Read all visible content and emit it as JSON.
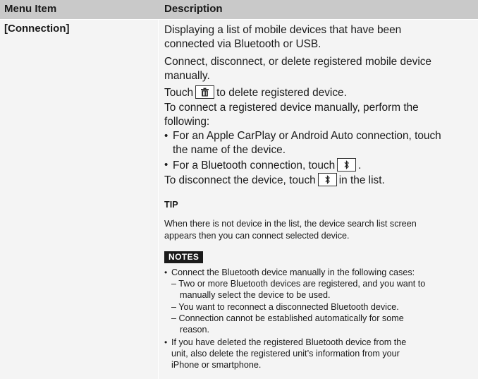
{
  "header": {
    "col1": "Menu Item",
    "col2": "Description"
  },
  "row": {
    "menu_item": "[Connection]",
    "lines": {
      "l1": "Displaying a list of mobile devices that have been",
      "l2": "connected via Bluetooth or USB.",
      "l3": "Connect, disconnect, or delete registered mobile device",
      "l4": "manually.",
      "l5a": "Touch",
      "l5b": "to delete registered device.",
      "l6": "To connect a registered device manually, perform the",
      "l7": "following:",
      "b1a": "For an Apple CarPlay or Android Auto connection, touch",
      "b1b": "the name of the device.",
      "b2a": "For a Bluetooth connection, touch",
      "b2b": ".",
      "l8a": "To disconnect the device, touch",
      "l8b": "in the list."
    },
    "tip": {
      "title": "TIP",
      "l1": "When there is not device in the list, the device search list screen",
      "l2": "appears then you can connect selected device."
    },
    "notes": {
      "title": "NOTES",
      "n1": "Connect the Bluetooth device manually in the following cases:",
      "n1a1": "– Two or more Bluetooth devices are registered, and you want to",
      "n1a2": "manually select the device to be used.",
      "n1b": "– You want to reconnect a disconnected Bluetooth device.",
      "n1c1": "– Connection cannot be established automatically for some",
      "n1c2": "reason.",
      "n2a": "If you have deleted the registered Bluetooth device from the",
      "n2b": "unit, also delete the registered unit’s information from your",
      "n2c": "iPhone or smartphone."
    }
  },
  "icons": {
    "delete": "trash-icon",
    "bluetooth": "bluetooth-icon",
    "bullet": "•"
  },
  "colors": {
    "header_bg": "#c9c9c9",
    "row_bg": "#f4f4f4",
    "badge_bg": "#1a1a1a"
  }
}
